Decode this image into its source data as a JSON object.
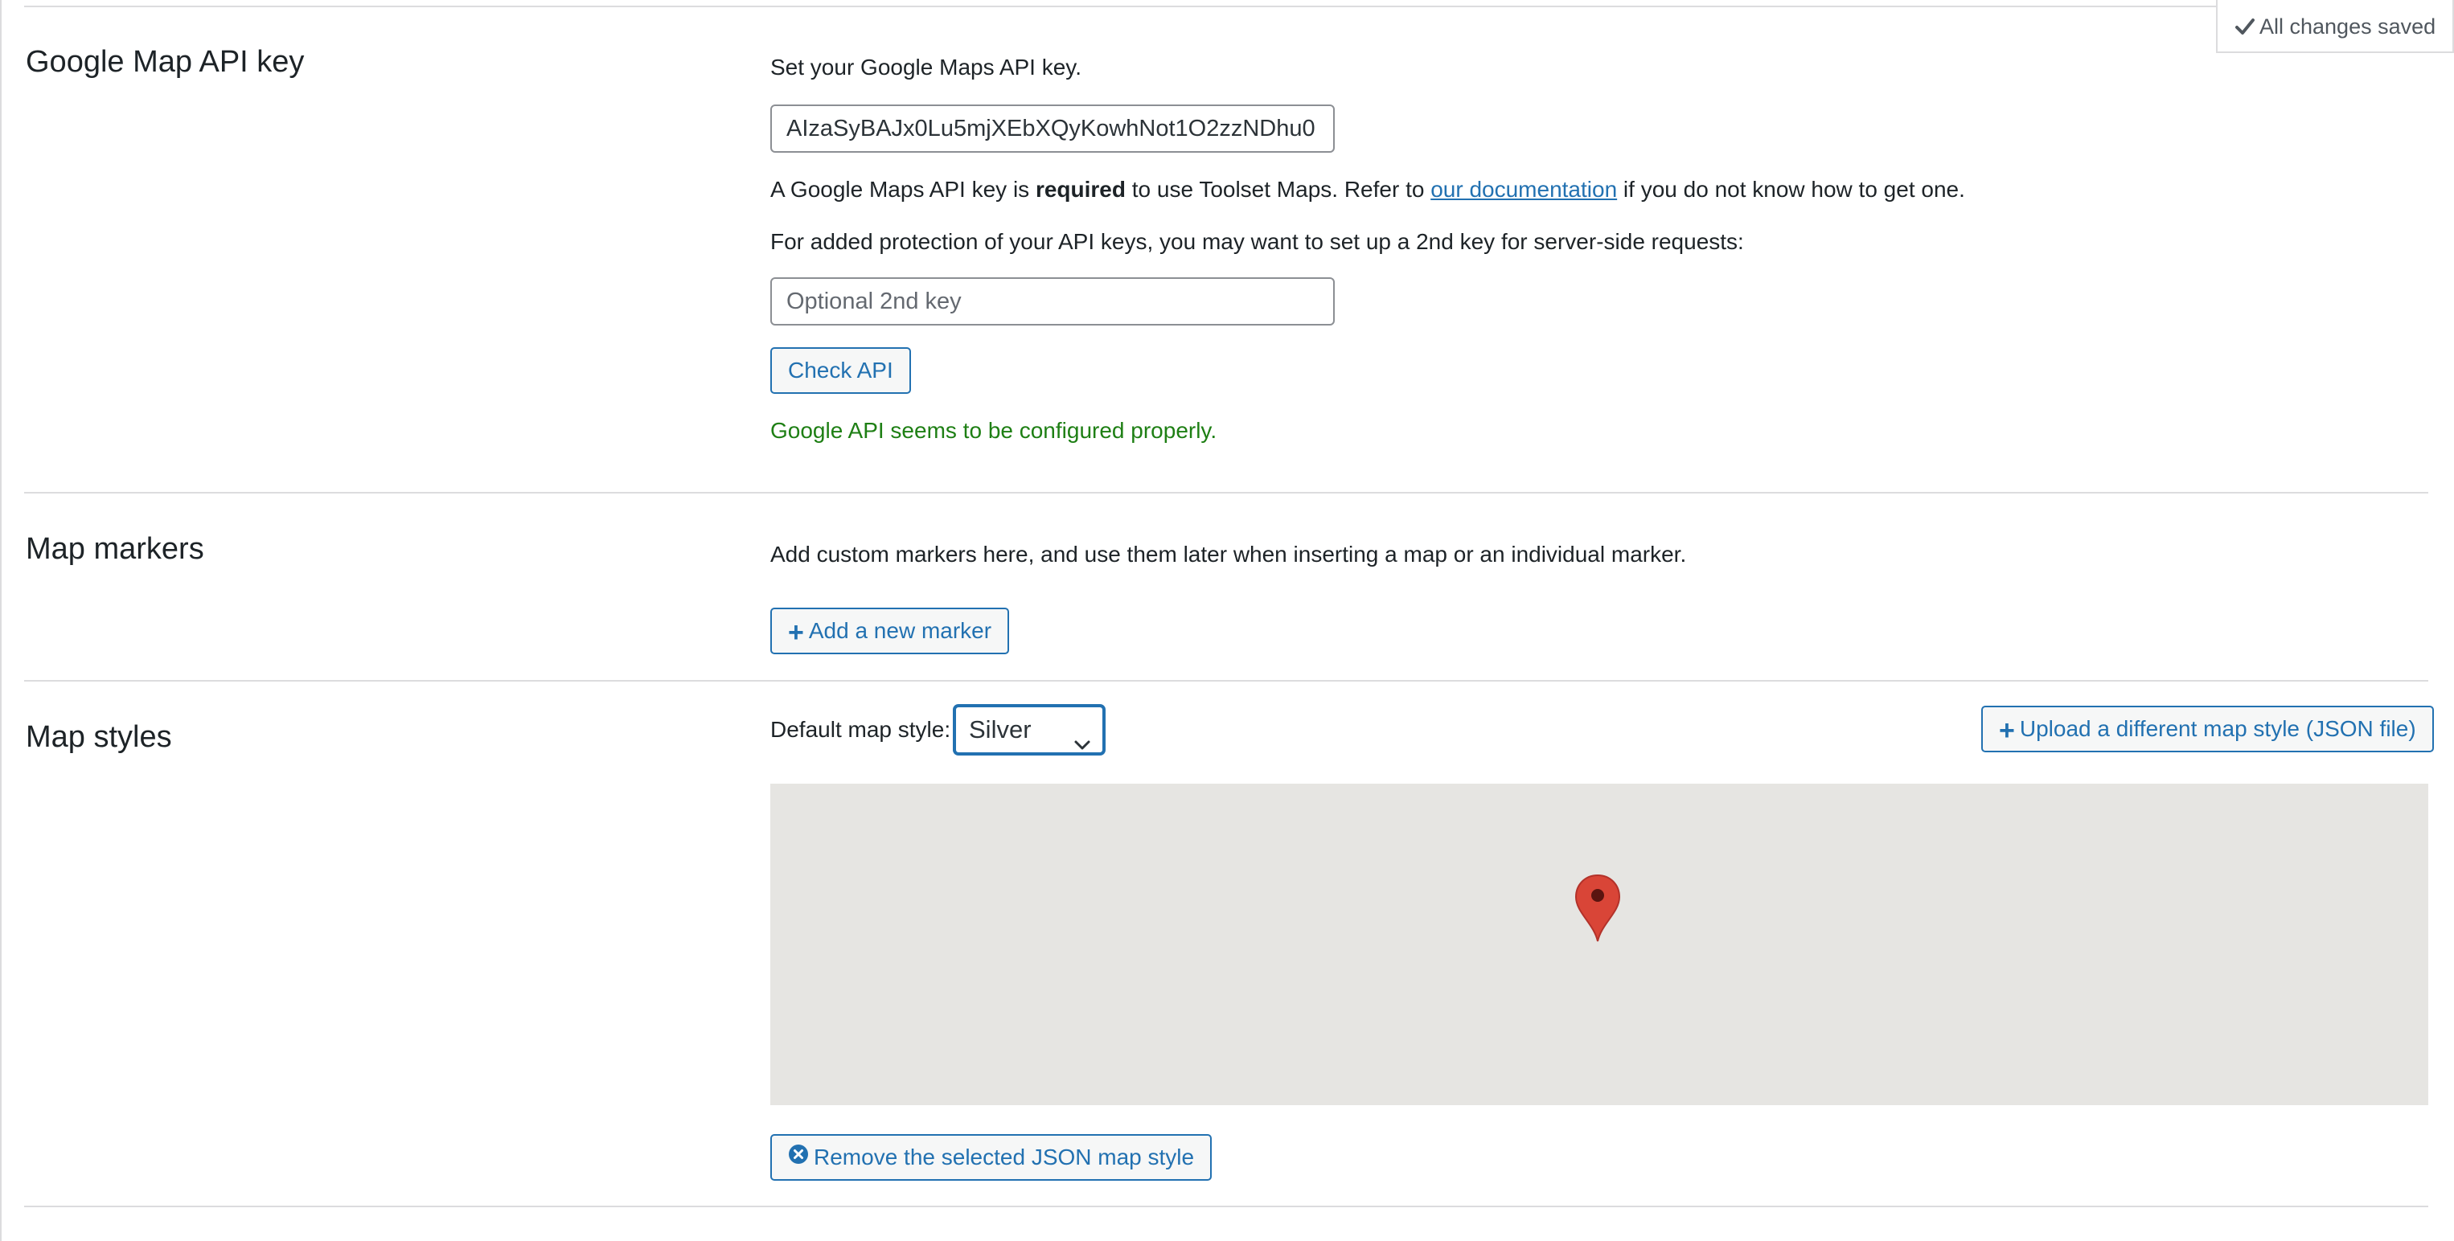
{
  "status": {
    "saved_label": "All changes saved"
  },
  "api_key_section": {
    "title": "Google Map API key",
    "intro": "Set your Google Maps API key.",
    "api_key_value": "AIzaSyBAJx0Lu5mjXEbXQyKowhNot1O2zzNDhu0",
    "note_prefix": "A Google Maps API key is ",
    "note_bold": "required",
    "note_middle": " to use Toolset Maps. Refer to ",
    "note_link": "our documentation",
    "note_suffix": " if you do not know how to get one.",
    "second_key_intro": "For added protection of your API keys, you may want to set up a 2nd key for server-side requests:",
    "second_key_placeholder": "Optional 2nd key",
    "check_button": "Check API",
    "status_message": "Google API seems to be configured properly."
  },
  "markers_section": {
    "title": "Map markers",
    "intro": "Add custom markers here, and use them later when inserting a map or an individual marker.",
    "add_button": "Add a new marker"
  },
  "styles_section": {
    "title": "Map styles",
    "default_label": "Default map style:",
    "selected_style": "Silver",
    "upload_button": "Upload a different map style (JSON file)",
    "remove_button": "Remove the selected JSON map style"
  },
  "colors": {
    "accent": "#2271b1",
    "success": "#1e7f14",
    "marker": "#d94537",
    "map_background": "#e6e5e2"
  }
}
